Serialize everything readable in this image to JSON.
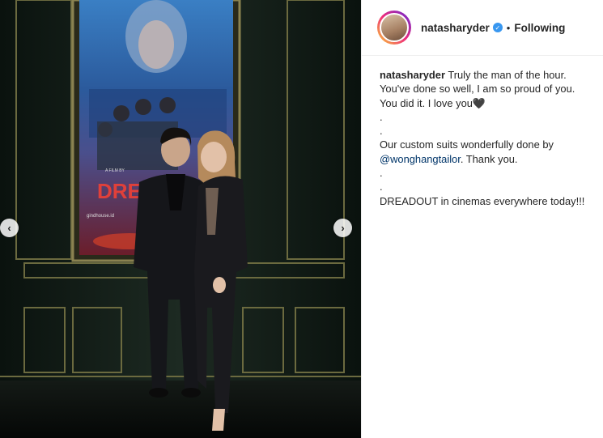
{
  "post": {
    "username": "natasharyder",
    "verified": true,
    "separator": "•",
    "follow_status": "Following"
  },
  "caption": {
    "username": "natasharyder",
    "line1": "Truly the man of the hour.",
    "line2": "You've done so well, I am so proud of you.",
    "line3": "You did it. I love you",
    "heart": "🖤",
    "dot1": ".",
    "dot2": ".",
    "line4": "Our custom suits wonderfully done by",
    "mention": "@wonghangtailor",
    "line5_rest": ". Thank you.",
    "dot3": ".",
    "dot4": ".",
    "line6": "DREADOUT in cinemas everywhere today!!!"
  },
  "photo": {
    "poster_text": "DRE",
    "poster_small_left": "A FILM BY",
    "poster_url_text": "gindhouse.id"
  },
  "navigation": {
    "prev_icon": "chevron-left-icon",
    "next_icon": "chevron-right-icon",
    "prev_glyph": "‹",
    "next_glyph": "›"
  },
  "colors": {
    "text": "#262626",
    "mention": "#003569",
    "verified": "#3897f0",
    "border": "#efefef"
  }
}
